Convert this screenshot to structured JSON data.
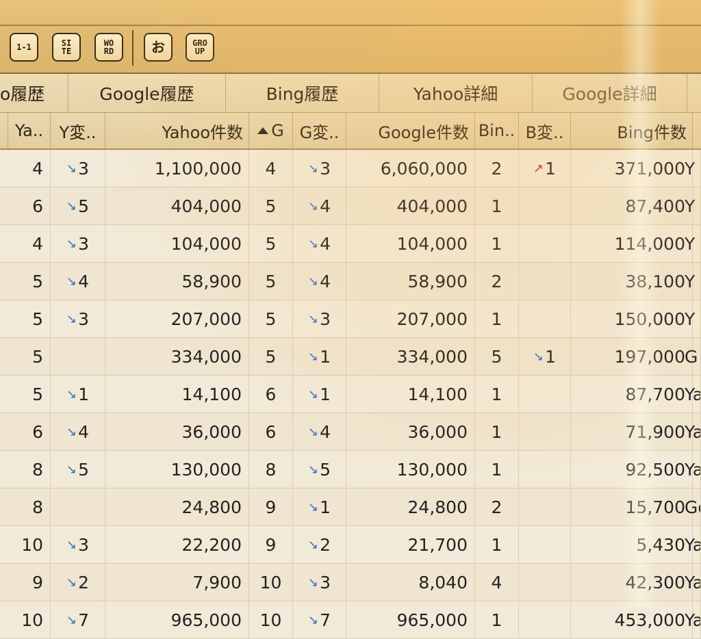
{
  "toolbar": {
    "buttons": [
      {
        "label": "1-1",
        "icon": "one-to-one"
      },
      {
        "label": "SI\nTE",
        "icon": "site"
      },
      {
        "label": "WO\nRD",
        "icon": "word"
      },
      {
        "label": "お",
        "icon": "hiragana-o"
      },
      {
        "label": "GRO\nUP",
        "icon": "group"
      }
    ]
  },
  "group_headers": [
    "o履歴",
    "Google履歴",
    "Bing履歴",
    "Yahoo詳細",
    "Google詳細"
  ],
  "columns": [
    "Ya..",
    "Y変..",
    "Yahoo件数",
    "G",
    "G変..",
    "Google件数",
    "Bin..",
    "B変..",
    "Bing件数"
  ],
  "rows": [
    {
      "ya": "4",
      "yc": "3",
      "yd": "down",
      "yn": "1,100,000",
      "g": "4",
      "gc": "3",
      "gd": "down",
      "gn": "6,060,000",
      "b": "2",
      "bc": "1",
      "bd": "up",
      "bn": "371,000",
      "eng": "Y"
    },
    {
      "ya": "6",
      "yc": "5",
      "yd": "down",
      "yn": "404,000",
      "g": "5",
      "gc": "4",
      "gd": "down",
      "gn": "404,000",
      "b": "1",
      "bc": "",
      "bd": "",
      "bn": "87,400",
      "eng": "Y"
    },
    {
      "ya": "4",
      "yc": "3",
      "yd": "down",
      "yn": "104,000",
      "g": "5",
      "gc": "4",
      "gd": "down",
      "gn": "104,000",
      "b": "1",
      "bc": "",
      "bd": "",
      "bn": "114,000",
      "eng": "Y"
    },
    {
      "ya": "5",
      "yc": "4",
      "yd": "down",
      "yn": "58,900",
      "g": "5",
      "gc": "4",
      "gd": "down",
      "gn": "58,900",
      "b": "2",
      "bc": "",
      "bd": "",
      "bn": "38,100",
      "eng": "Y"
    },
    {
      "ya": "5",
      "yc": "3",
      "yd": "down",
      "yn": "207,000",
      "g": "5",
      "gc": "3",
      "gd": "down",
      "gn": "207,000",
      "b": "1",
      "bc": "",
      "bd": "",
      "bn": "150,000",
      "eng": "Y"
    },
    {
      "ya": "5",
      "yc": "",
      "yd": "",
      "yn": "334,000",
      "g": "5",
      "gc": "1",
      "gd": "down",
      "gn": "334,000",
      "b": "5",
      "bc": "1",
      "bd": "down",
      "bn": "197,000",
      "eng": "G"
    },
    {
      "ya": "5",
      "yc": "1",
      "yd": "down",
      "yn": "14,100",
      "g": "6",
      "gc": "1",
      "gd": "down",
      "gn": "14,100",
      "b": "1",
      "bc": "",
      "bd": "",
      "bn": "87,700",
      "eng": "Ya"
    },
    {
      "ya": "6",
      "yc": "4",
      "yd": "down",
      "yn": "36,000",
      "g": "6",
      "gc": "4",
      "gd": "down",
      "gn": "36,000",
      "b": "1",
      "bc": "",
      "bd": "",
      "bn": "71,900",
      "eng": "Ya"
    },
    {
      "ya": "8",
      "yc": "5",
      "yd": "down",
      "yn": "130,000",
      "g": "8",
      "gc": "5",
      "gd": "down",
      "gn": "130,000",
      "b": "1",
      "bc": "",
      "bd": "",
      "bn": "92,500",
      "eng": "Ya"
    },
    {
      "ya": "8",
      "yc": "",
      "yd": "",
      "yn": "24,800",
      "g": "9",
      "gc": "1",
      "gd": "down",
      "gn": "24,800",
      "b": "2",
      "bc": "",
      "bd": "",
      "bn": "15,700",
      "eng": "Go"
    },
    {
      "ya": "10",
      "yc": "3",
      "yd": "down",
      "yn": "22,200",
      "g": "9",
      "gc": "2",
      "gd": "down",
      "gn": "21,700",
      "b": "1",
      "bc": "",
      "bd": "",
      "bn": "5,430",
      "eng": "Ya"
    },
    {
      "ya": "9",
      "yc": "2",
      "yd": "down",
      "yn": "7,900",
      "g": "10",
      "gc": "3",
      "gd": "down",
      "gn": "8,040",
      "b": "4",
      "bc": "",
      "bd": "",
      "bn": "42,300",
      "eng": "Yal"
    },
    {
      "ya": "10",
      "yc": "7",
      "yd": "down",
      "yn": "965,000",
      "g": "10",
      "gc": "7",
      "gd": "down",
      "gn": "965,000",
      "b": "1",
      "bc": "",
      "bd": "",
      "bn": "453,000",
      "eng": "Yal"
    }
  ]
}
